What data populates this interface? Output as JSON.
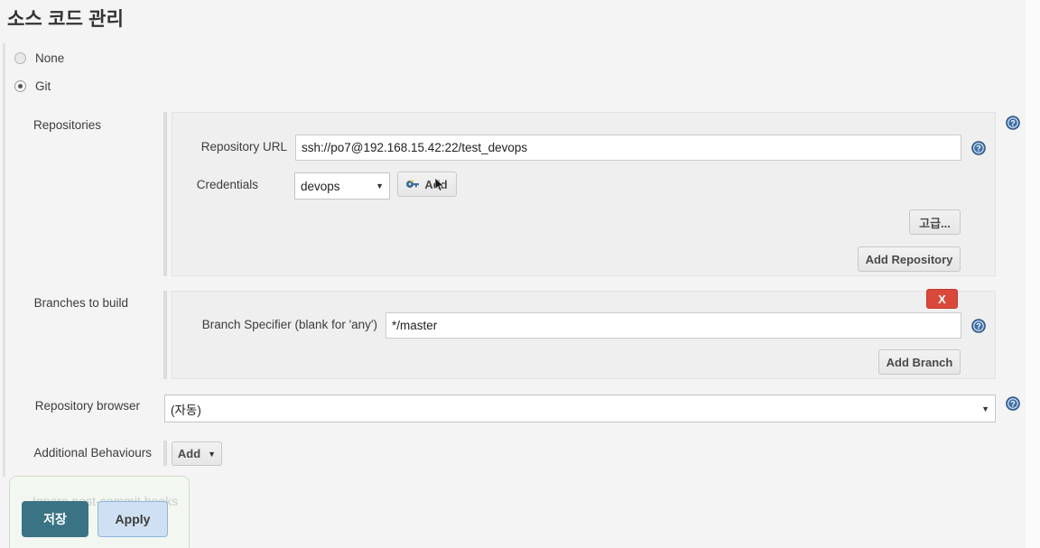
{
  "page": {
    "title": "소스 코드 관리"
  },
  "scm_options": [
    {
      "label": "None",
      "selected": false,
      "name": "none"
    },
    {
      "label": "Git",
      "selected": true,
      "name": "git"
    }
  ],
  "repositories": {
    "section_label": "Repositories",
    "repository_url": {
      "label": "Repository URL",
      "value": "ssh://po7@192.168.15.42:22/test_devops",
      "placeholder": ""
    },
    "credentials": {
      "label": "Credentials",
      "value": "devops",
      "caret": "▼",
      "add_button": "Add",
      "add_icon": "key-icon"
    },
    "advanced_button": "고급...",
    "add_repository_button": "Add Repository",
    "help_icon": "help-icon"
  },
  "branches": {
    "section_label": "Branches to build",
    "delete_button": "X",
    "branch_specifier": {
      "label": "Branch Specifier (blank for 'any')",
      "value": "*/master",
      "placeholder": ""
    },
    "add_branch_button": "Add Branch",
    "help_icon": "help-icon"
  },
  "repository_browser": {
    "label": "Repository browser",
    "value": "(자동)",
    "caret": "▼",
    "help_icon": "help-icon"
  },
  "additional_behaviours": {
    "label": "Additional Behaviours",
    "add_button": "Add",
    "caret": "▼"
  },
  "bottom_bar": {
    "ghost_text": "Ignore post-commit hooks",
    "save_button": "저장",
    "apply_button": "Apply"
  },
  "colors": {
    "accent_teal": "#3a7384",
    "apply_blue": "#cfe0f2",
    "delete_red": "#d9483b",
    "help_blue": "#3f6fa8",
    "panel_bg": "#efefef",
    "page_bg": "#f4f4f4"
  }
}
